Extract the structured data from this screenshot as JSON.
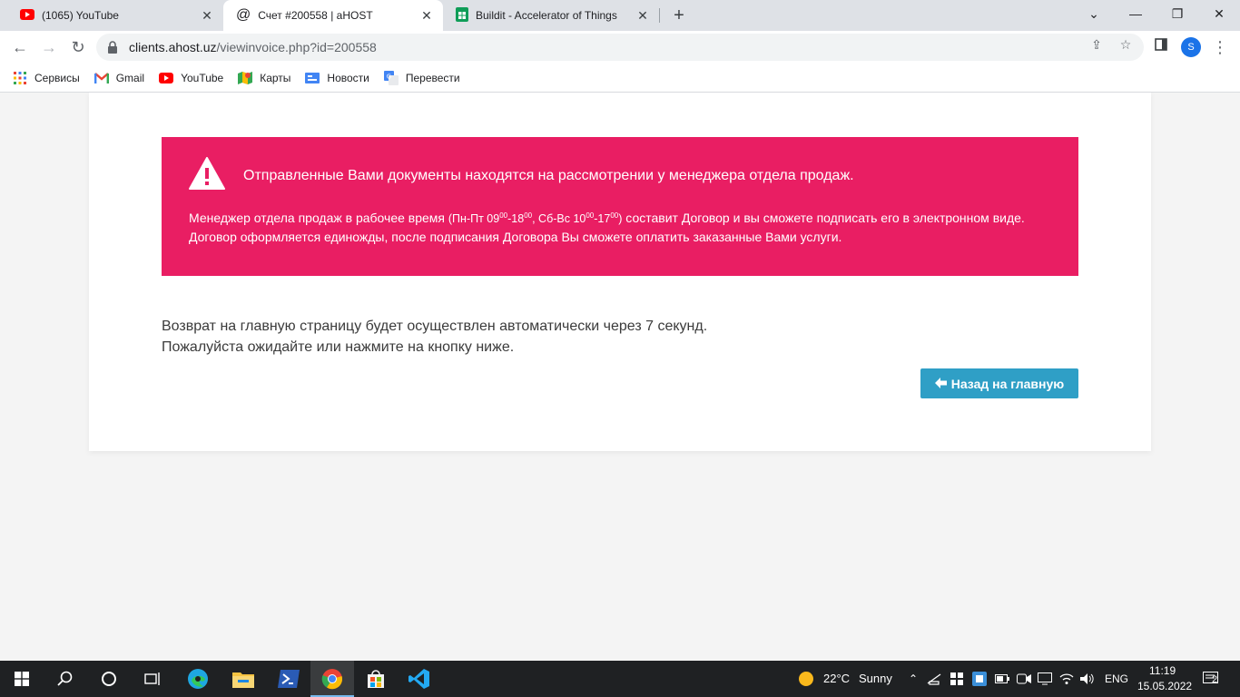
{
  "browser": {
    "tabs": [
      {
        "title": "(1065) YouTube",
        "icon": "youtube-icon"
      },
      {
        "title": "Счет #200558 | aHOST",
        "icon": "at-icon"
      },
      {
        "title": "Buildit - Accelerator of Things",
        "icon": "sheets-icon"
      }
    ],
    "url_host": "clients.ahost.uz",
    "url_path": "/viewinvoice.php?id=200558",
    "profile_initial": "S"
  },
  "bookmarks": [
    {
      "label": "Сервисы",
      "icon": "apps-grid-icon"
    },
    {
      "label": "Gmail",
      "icon": "gmail-icon"
    },
    {
      "label": "YouTube",
      "icon": "youtube-icon"
    },
    {
      "label": "Карты",
      "icon": "maps-icon"
    },
    {
      "label": "Новости",
      "icon": "news-icon"
    },
    {
      "label": "Перевести",
      "icon": "translate-icon"
    }
  ],
  "alert": {
    "title": "Отправленные Вами документы находятся на рассмотрении у менеджера отдела продаж.",
    "line1_a": "Менеджер отдела продаж в рабочее время ",
    "hours_a": "(Пн-Пт 09",
    "sup1": "00",
    "hours_b": "-18",
    "sup2": "00",
    "hours_c": ", Сб-Вс 10",
    "sup3": "00",
    "hours_d": "-17",
    "sup4": "00",
    "hours_e": ")",
    "line1_b": " составит Договор и вы сможете подписать его в электронном виде.",
    "line2": "Договор оформляется единожды, после подписания Договора Вы сможете оплатить заказанные Вами услуги.",
    "color": "#e91e63"
  },
  "redirect": {
    "line1": "Возврат на главную страницу будет осуществлен автоматически через 7 секунд.",
    "line2": "Пожалуйста ожидайте или нажмите на кнопку ниже."
  },
  "back_button": {
    "label": "Назад на главную",
    "color": "#2f9fc6"
  },
  "taskbar": {
    "weather_temp": "22°C",
    "weather_text": "Sunny",
    "language": "ENG",
    "time": "11:19",
    "date": "15.05.2022",
    "notifications": "2"
  }
}
